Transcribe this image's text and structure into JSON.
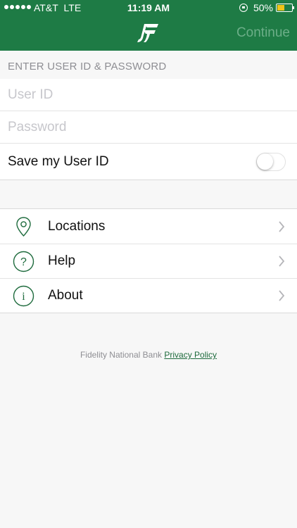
{
  "status_bar": {
    "carrier": "AT&T",
    "network": "LTE",
    "time": "11:19 AM",
    "battery": "50%",
    "battery_level": 0.5
  },
  "header": {
    "logo_icon": "fidelity-logo-icon",
    "continue_label": "Continue"
  },
  "login": {
    "section_title": "ENTER USER ID & PASSWORD",
    "user_id_placeholder": "User ID",
    "password_placeholder": "Password",
    "save_user_id_label": "Save my User ID",
    "save_user_id_on": false
  },
  "menu": {
    "items": [
      {
        "label": "Locations",
        "icon": "location-pin-icon"
      },
      {
        "label": "Help",
        "icon": "question-icon"
      },
      {
        "label": "About",
        "icon": "info-icon"
      }
    ]
  },
  "footer": {
    "bank_name": "Fidelity National Bank",
    "privacy_link": "Privacy Policy"
  },
  "colors": {
    "brand_green": "#1e7b45",
    "continue_disabled": "#6cae88",
    "icon_green": "#1e6b3d"
  }
}
